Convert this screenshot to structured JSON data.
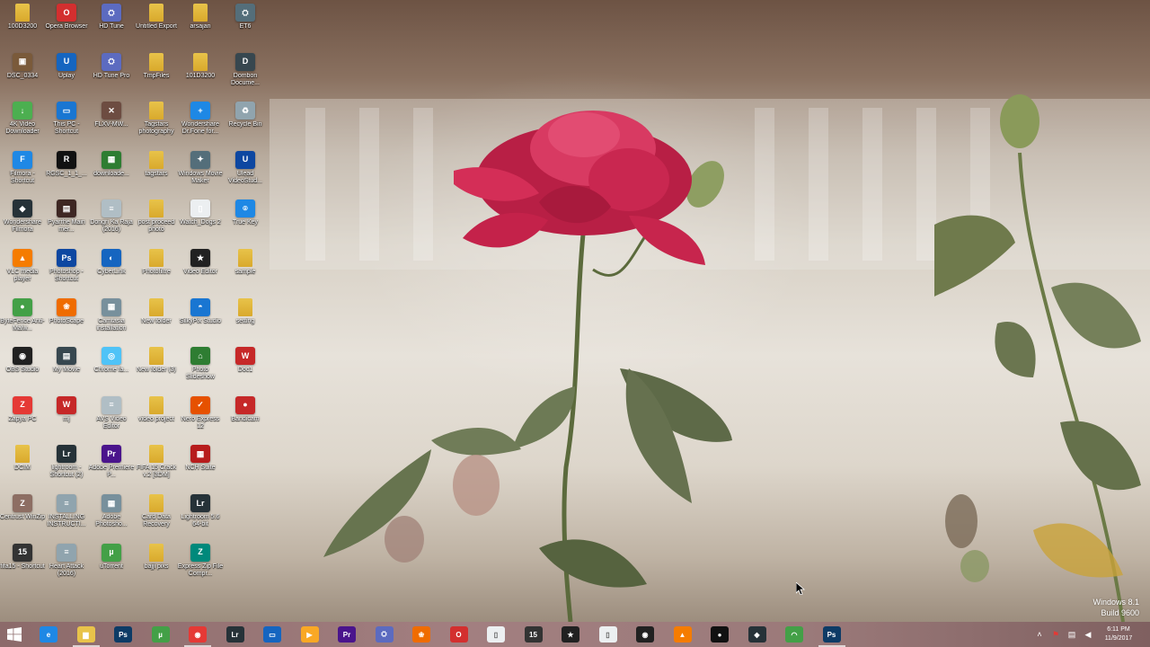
{
  "colors": {
    "folder": "#e8c34a",
    "taskbar": "#9b7a7a",
    "rose": "#c8244a"
  },
  "desktop_icons": [
    {
      "label": "100D3200",
      "icon": "folder-icon",
      "kind": "folder"
    },
    {
      "label": "DSC_0334",
      "icon": "photo-icon",
      "kind": "app",
      "color": "#7a5a3a",
      "glyph": "▣"
    },
    {
      "label": "4K Video Downloader",
      "icon": "4k-downloader-icon",
      "kind": "app",
      "color": "#4caf50",
      "glyph": "↓"
    },
    {
      "label": "Filmora - Shortcut",
      "icon": "filmora-icon",
      "kind": "app",
      "color": "#1e88e5",
      "glyph": "F"
    },
    {
      "label": "Wondershare Filmora",
      "icon": "filmora-icon",
      "kind": "app",
      "color": "#263238",
      "glyph": "◆"
    },
    {
      "label": "VLC media player",
      "icon": "vlc-icon",
      "kind": "app",
      "color": "#f57c00",
      "glyph": "▲"
    },
    {
      "label": "ByteFence Anti-Malw...",
      "icon": "bytefence-icon",
      "kind": "app",
      "color": "#43a047",
      "glyph": "●"
    },
    {
      "label": "OBS Studio",
      "icon": "obs-icon",
      "kind": "app",
      "color": "#212121",
      "glyph": "◉"
    },
    {
      "label": "Zapya PC",
      "icon": "zapya-icon",
      "kind": "app",
      "color": "#e53935",
      "glyph": "Z"
    },
    {
      "label": "DCIM",
      "icon": "folder-icon",
      "kind": "folder"
    },
    {
      "label": "Centrust WinZip",
      "icon": "winzip-icon",
      "kind": "app",
      "color": "#8d6e63",
      "glyph": "Z"
    },
    {
      "label": "fifa15 - Shortcut",
      "icon": "fifa-icon",
      "kind": "app",
      "color": "#333333",
      "glyph": "15"
    },
    {
      "label": "Opera Browser",
      "icon": "opera-icon",
      "kind": "app",
      "color": "#d32f2f",
      "glyph": "O"
    },
    {
      "label": "Uplay",
      "icon": "uplay-icon",
      "kind": "app",
      "color": "#1565c0",
      "glyph": "U"
    },
    {
      "label": "This PC - Shortcut",
      "icon": "this-pc-icon",
      "kind": "app",
      "color": "#1976d2",
      "glyph": "▭"
    },
    {
      "label": "RGSC_1_1_...",
      "icon": "rockstar-icon",
      "kind": "app",
      "color": "#111111",
      "glyph": "R"
    },
    {
      "label": "Pyarrhe Main mer...",
      "icon": "video-icon",
      "kind": "app",
      "color": "#3e2723",
      "glyph": "▤"
    },
    {
      "label": "Photoshop - Shortcut",
      "icon": "photoshop-icon",
      "kind": "app",
      "color": "#0d47a1",
      "glyph": "Ps"
    },
    {
      "label": "PhotoScape",
      "icon": "photoscape-icon",
      "kind": "app",
      "color": "#ef6c00",
      "glyph": "❀"
    },
    {
      "label": "My Movie",
      "icon": "movie-icon",
      "kind": "app",
      "color": "#37474f",
      "glyph": "▤"
    },
    {
      "label": "mj",
      "icon": "office-icon",
      "kind": "app",
      "color": "#c62828",
      "glyph": "W"
    },
    {
      "label": "lightroom - Shortcut (2)",
      "icon": "lightroom-icon",
      "kind": "app",
      "color": "#263238",
      "glyph": "Lr"
    },
    {
      "label": "INSTALLING INSTRUCTI...",
      "icon": "document-icon",
      "kind": "app",
      "color": "#90a4ae",
      "glyph": "≡"
    },
    {
      "label": "Heart Attack (2016)",
      "icon": "document-icon",
      "kind": "app",
      "color": "#90a4ae",
      "glyph": "≡"
    },
    {
      "label": "HD Tune",
      "icon": "hd-tune-icon",
      "kind": "app",
      "color": "#5c6bc0",
      "glyph": "⛭"
    },
    {
      "label": "HD Tune Pro",
      "icon": "hd-tune-icon",
      "kind": "app",
      "color": "#5c6bc0",
      "glyph": "⛭"
    },
    {
      "label": "FLXV-MW...",
      "icon": "archive-icon",
      "kind": "app",
      "color": "#6d4c41",
      "glyph": "✕"
    },
    {
      "label": "downloade...",
      "icon": "flag-icon",
      "kind": "app",
      "color": "#2e7d32",
      "glyph": "▦"
    },
    {
      "label": "Dongri Ka Raja (2016)",
      "icon": "document-icon",
      "kind": "app",
      "color": "#b0bec5",
      "glyph": "≡"
    },
    {
      "label": "CyberLink",
      "icon": "cyberlink-icon",
      "kind": "app",
      "color": "#1565c0",
      "glyph": "◐"
    },
    {
      "label": "Camtasia installation",
      "icon": "installer-icon",
      "kind": "app",
      "color": "#78909c",
      "glyph": "▦"
    },
    {
      "label": "Chrome fa...",
      "icon": "chrome-installer-icon",
      "kind": "app",
      "color": "#4fc3f7",
      "glyph": "◎"
    },
    {
      "label": "AVS Video Editor",
      "icon": "document-icon",
      "kind": "app",
      "color": "#b0bec5",
      "glyph": "≡"
    },
    {
      "label": "Adobe Premiere P...",
      "icon": "premiere-icon",
      "kind": "app",
      "color": "#4a148c",
      "glyph": "Pr"
    },
    {
      "label": "Adobe Photosho...",
      "icon": "installer-icon",
      "kind": "app",
      "color": "#78909c",
      "glyph": "▦"
    },
    {
      "label": "uTorrent",
      "icon": "utorrent-icon",
      "kind": "app",
      "color": "#43a047",
      "glyph": "µ"
    },
    {
      "label": "Untitled Export",
      "icon": "folder-icon",
      "kind": "folder"
    },
    {
      "label": "TmpFiles",
      "icon": "folder-icon",
      "kind": "folder"
    },
    {
      "label": "Tagstars photography",
      "icon": "folder-icon",
      "kind": "folder"
    },
    {
      "label": "tagstars",
      "icon": "folder-icon",
      "kind": "folder"
    },
    {
      "label": "post proceed photo",
      "icon": "folder-icon",
      "kind": "folder"
    },
    {
      "label": "Photofiltre",
      "icon": "folder-icon",
      "kind": "folder"
    },
    {
      "label": "New folder",
      "icon": "folder-icon",
      "kind": "folder"
    },
    {
      "label": "New folder (3)",
      "icon": "folder-icon",
      "kind": "folder"
    },
    {
      "label": "video project",
      "icon": "folder-icon",
      "kind": "folder"
    },
    {
      "label": "FIFA 15 Crack v.2 [3DM]",
      "icon": "folder-icon",
      "kind": "folder"
    },
    {
      "label": "Card Data Recovery",
      "icon": "folder-icon",
      "kind": "folder"
    },
    {
      "label": "bajji pixs",
      "icon": "folder-icon",
      "kind": "folder"
    },
    {
      "label": "arsajan",
      "icon": "folder-icon",
      "kind": "folder"
    },
    {
      "label": "101D3200",
      "icon": "folder-icon",
      "kind": "folder"
    },
    {
      "label": "Wondershare Dr.Fone for...",
      "icon": "drfone-icon",
      "kind": "app",
      "color": "#1e88e5",
      "glyph": "+"
    },
    {
      "label": "Windows Movie Maker",
      "icon": "movie-maker-icon",
      "kind": "app",
      "color": "#546e7a",
      "glyph": "✦"
    },
    {
      "label": "Watch_Dogs 2",
      "icon": "document-icon",
      "kind": "app",
      "color": "#eceff1",
      "glyph": "▯"
    },
    {
      "label": "Video Editor",
      "icon": "video-editor-icon",
      "kind": "app",
      "color": "#212121",
      "glyph": "★"
    },
    {
      "label": "SilkyPix Studio",
      "icon": "photo-app-icon",
      "kind": "app",
      "color": "#1976d2",
      "glyph": "◓"
    },
    {
      "label": "Photo Slideshow",
      "icon": "slideshow-icon",
      "kind": "app",
      "color": "#2e7d32",
      "glyph": "⌂"
    },
    {
      "label": "Nero Express 12",
      "icon": "nero-icon",
      "kind": "app",
      "color": "#e65100",
      "glyph": "✓"
    },
    {
      "label": "NCH Suite",
      "icon": "nch-icon",
      "kind": "app",
      "color": "#b71c1c",
      "glyph": "▦"
    },
    {
      "label": "Lightroom 5.6 64-bit",
      "icon": "lightroom-icon",
      "kind": "app",
      "color": "#263238",
      "glyph": "Lr"
    },
    {
      "label": "Express Zip File Compr...",
      "icon": "express-zip-icon",
      "kind": "app",
      "color": "#00897b",
      "glyph": "Z"
    },
    {
      "label": "ET6",
      "icon": "et6-icon",
      "kind": "app",
      "color": "#546e7a",
      "glyph": "⛭"
    },
    {
      "label": "Dombon Docume...",
      "icon": "document-app-icon",
      "kind": "app",
      "color": "#37474f",
      "glyph": "D"
    },
    {
      "label": "Recycle Bin",
      "icon": "recycle-bin-icon",
      "kind": "app",
      "color": "#90a4ae",
      "glyph": "♻"
    },
    {
      "label": "Ulead VideoStud...",
      "icon": "ulead-icon",
      "kind": "app",
      "color": "#0d47a1",
      "glyph": "U"
    },
    {
      "label": "True Key",
      "icon": "true-key-icon",
      "kind": "app",
      "color": "#1e88e5",
      "glyph": "⌾"
    },
    {
      "label": "sample",
      "icon": "folder-icon",
      "kind": "folder"
    },
    {
      "label": "setting",
      "icon": "folder-icon",
      "kind": "folder"
    },
    {
      "label": "Doc1",
      "icon": "office-icon",
      "kind": "app",
      "color": "#c62828",
      "glyph": "W"
    },
    {
      "label": "Bandicam",
      "icon": "bandicam-icon",
      "kind": "app",
      "color": "#c62828",
      "glyph": "●"
    }
  ],
  "taskbar": {
    "start_label": "Start",
    "items": [
      {
        "name": "internet-explorer",
        "icon": "internet-explorer-icon",
        "color": "#1e88e5",
        "glyph": "e"
      },
      {
        "name": "file-explorer",
        "icon": "folder-icon",
        "color": "#e8c34a",
        "glyph": "▆",
        "active": true
      },
      {
        "name": "photoshop",
        "icon": "photoshop-icon",
        "color": "#0d3b66",
        "glyph": "Ps"
      },
      {
        "name": "utorrent",
        "icon": "utorrent-icon",
        "color": "#43a047",
        "glyph": "µ"
      },
      {
        "name": "chrome",
        "icon": "chrome-icon",
        "color": "#e53935",
        "glyph": "◉",
        "active": true
      },
      {
        "name": "lightroom",
        "icon": "lightroom-icon",
        "color": "#263238",
        "glyph": "Lr"
      },
      {
        "name": "this-pc",
        "icon": "computer-icon",
        "color": "#1565c0",
        "glyph": "▭"
      },
      {
        "name": "media-player",
        "icon": "media-player-icon",
        "color": "#f9a825",
        "glyph": "▶"
      },
      {
        "name": "premiere",
        "icon": "premiere-icon",
        "color": "#4a148c",
        "glyph": "Pr"
      },
      {
        "name": "hd-tune",
        "icon": "hd-tune-icon",
        "color": "#5c6bc0",
        "glyph": "⛭"
      },
      {
        "name": "photoscape",
        "icon": "photoscape-icon",
        "color": "#ef6c00",
        "glyph": "❀"
      },
      {
        "name": "opera",
        "icon": "opera-icon",
        "color": "#d32f2f",
        "glyph": "O"
      },
      {
        "name": "document",
        "icon": "document-icon",
        "color": "#eceff1",
        "glyph": "▯"
      },
      {
        "name": "fifa15",
        "icon": "fifa-icon",
        "color": "#333333",
        "glyph": "15"
      },
      {
        "name": "video-editor",
        "icon": "video-editor-icon",
        "color": "#212121",
        "glyph": "★"
      },
      {
        "name": "document-2",
        "icon": "document-icon",
        "color": "#eceff1",
        "glyph": "▯"
      },
      {
        "name": "obs",
        "icon": "obs-icon",
        "color": "#212121",
        "glyph": "◉"
      },
      {
        "name": "vlc",
        "icon": "vlc-icon",
        "color": "#f57c00",
        "glyph": "▲"
      },
      {
        "name": "bandicam",
        "icon": "record-icon",
        "color": "#111111",
        "glyph": "●"
      },
      {
        "name": "filmora",
        "icon": "filmora-icon",
        "color": "#263238",
        "glyph": "◆"
      },
      {
        "name": "uplay-green",
        "icon": "android-icon",
        "color": "#43a047",
        "glyph": "◠"
      },
      {
        "name": "photoshop-2",
        "icon": "photoshop-icon",
        "color": "#0d3b66",
        "glyph": "Ps",
        "active": true
      }
    ],
    "clock_time": "6:11 PM",
    "clock_date": "11/9/2017"
  },
  "watermark": {
    "line1": "Windows 8.1",
    "line2": "Build 9600"
  }
}
